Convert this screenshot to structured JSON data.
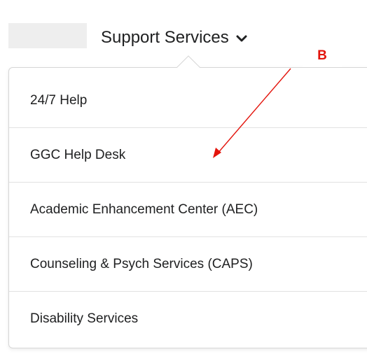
{
  "nav": {
    "menu_title": "Support Services",
    "chevron_icon": "chevron-down-icon"
  },
  "dropdown": {
    "items": [
      {
        "label": "24/7 Help"
      },
      {
        "label": "GGC Help Desk"
      },
      {
        "label": "Academic Enhancement Center (AEC)"
      },
      {
        "label": "Counseling & Psych Services (CAPS)"
      },
      {
        "label": "Disability Services"
      }
    ]
  },
  "annotation": {
    "label": "B",
    "color": "#e3140c"
  }
}
